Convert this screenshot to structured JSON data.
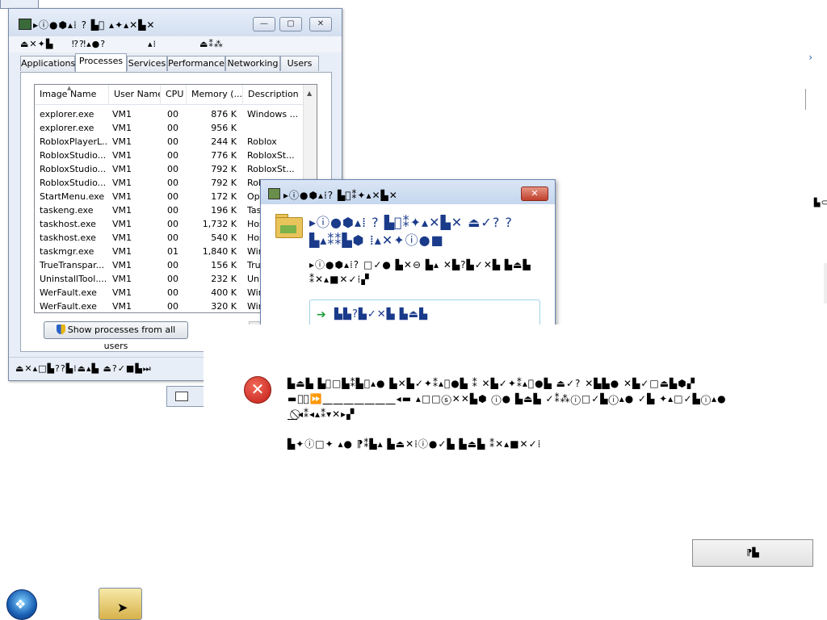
{
  "task_manager": {
    "title": "▸ⓘ●⬢▴⁞ ? ▙⃠ ▴✦▴✕▙✕",
    "menu": [
      "⏏✕✦▙",
      "⁉⁈▴●?",
      "▴⁞ ",
      "⏏⁑⁂"
    ],
    "tabs": [
      "Applications",
      "Processes",
      "Services",
      "Performance",
      "Networking",
      "Users"
    ],
    "columns": [
      "Image Name",
      "User Name",
      "CPU",
      "Memory (...",
      "Description"
    ],
    "rows": [
      {
        "name": "explorer.exe",
        "user": "VM1",
        "cpu": "00",
        "mem": "876 K",
        "desc": "Windows ..."
      },
      {
        "name": "explorer.exe",
        "user": "VM1",
        "cpu": "00",
        "mem": "956 K",
        "desc": ""
      },
      {
        "name": "RobloxPlayerL...",
        "user": "VM1",
        "cpu": "00",
        "mem": "244 K",
        "desc": "Roblox"
      },
      {
        "name": "RobloxStudio...",
        "user": "VM1",
        "cpu": "00",
        "mem": "776 K",
        "desc": "RobloxSt..."
      },
      {
        "name": "RobloxStudio...",
        "user": "VM1",
        "cpu": "00",
        "mem": "792 K",
        "desc": "RobloxSt..."
      },
      {
        "name": "RobloxStudio...",
        "user": "VM1",
        "cpu": "00",
        "mem": "792 K",
        "desc": "RobloxSt..."
      },
      {
        "name": "StartMenu.exe",
        "user": "VM1",
        "cpu": "00",
        "mem": "172 K",
        "desc": "Ope..."
      },
      {
        "name": "taskeng.exe",
        "user": "VM1",
        "cpu": "00",
        "mem": "196 K",
        "desc": "Tas..."
      },
      {
        "name": "taskhost.exe",
        "user": "VM1",
        "cpu": "00",
        "mem": "1,732 K",
        "desc": "Hos..."
      },
      {
        "name": "taskhost.exe",
        "user": "VM1",
        "cpu": "00",
        "mem": "540 K",
        "desc": "Hos..."
      },
      {
        "name": "taskmgr.exe",
        "user": "VM1",
        "cpu": "01",
        "mem": "1,840 K",
        "desc": "Win..."
      },
      {
        "name": "TrueTranspar...",
        "user": "VM1",
        "cpu": "00",
        "mem": "156 K",
        "desc": "Tru..."
      },
      {
        "name": "UninstallTool....",
        "user": "VM1",
        "cpu": "00",
        "mem": "232 K",
        "desc": "Uni..."
      },
      {
        "name": "WerFault.exe",
        "user": "VM1",
        "cpu": "00",
        "mem": "400 K",
        "desc": "Win..."
      },
      {
        "name": "WerFault.exe",
        "user": "VM1",
        "cpu": "00",
        "mem": "320 K",
        "desc": "Win..."
      }
    ],
    "show_all_label": "Show processes from all users",
    "status": "⏏✕▴□▙??▙⁞⏏▴▙ ⏏?✓■▙⏭"
  },
  "dialog": {
    "title": "▸ⓘ●⬢▴⁞? ▙⃠⁑✦▴✕▙✕",
    "main_instruction": "▸ⓘ●⬢▴⁞ ? ▙⃠⁑✦▴✕▙✕ ⏏✓? ?▙▴⁑⁑▙⬢ ⁞▴✕✦ⓘ●■",
    "content": "▸ⓘ●⬢▴⁞? □✓● ▙✕⊖ ▙▴ ✕▙?▙✓✕▙ ▙⏏▙ ⁑✕▴■✕✓⁞▞",
    "link": "▙▙?▙✓✕▙ ▙⏏▙"
  },
  "error": {
    "paragraph1": "▙⏏▙ ▙⃠□▙⁑▙ⓘ▴● ▙✕▙✓✦⁑▴ⓘ●▙ ⁑ ✕▙✓✦⁑▴ⓘ●▙ ⏏✓? ✕▙▙● ✕▙✓□⏏▙⬢▞ ▬⎽⃠⏩⎽⎽⎽⎽⎽⎽⎽◂▬ ▴□□ⓢ✕✕▙⬢ ⓘ● ▙⏏▙ ✓⁑⁂ⓘ□✓▙ⓘ▴● ✓▙ ✦▴□✓▙ⓘ▴● ⎽⃠◂⁑◂▴⁑▾✕▸▞",
    "paragraph2": "▙✦ⓘ□✦ ▴● ⁋⁑▙▴ ▙⏏✕⁞ⓘ●✓▙ ▙⏏▙ ⁑✕▴■✕✓⁞",
    "ok_label": "⁋▙"
  },
  "taskbar": {
    "start_glyph": "❖"
  }
}
